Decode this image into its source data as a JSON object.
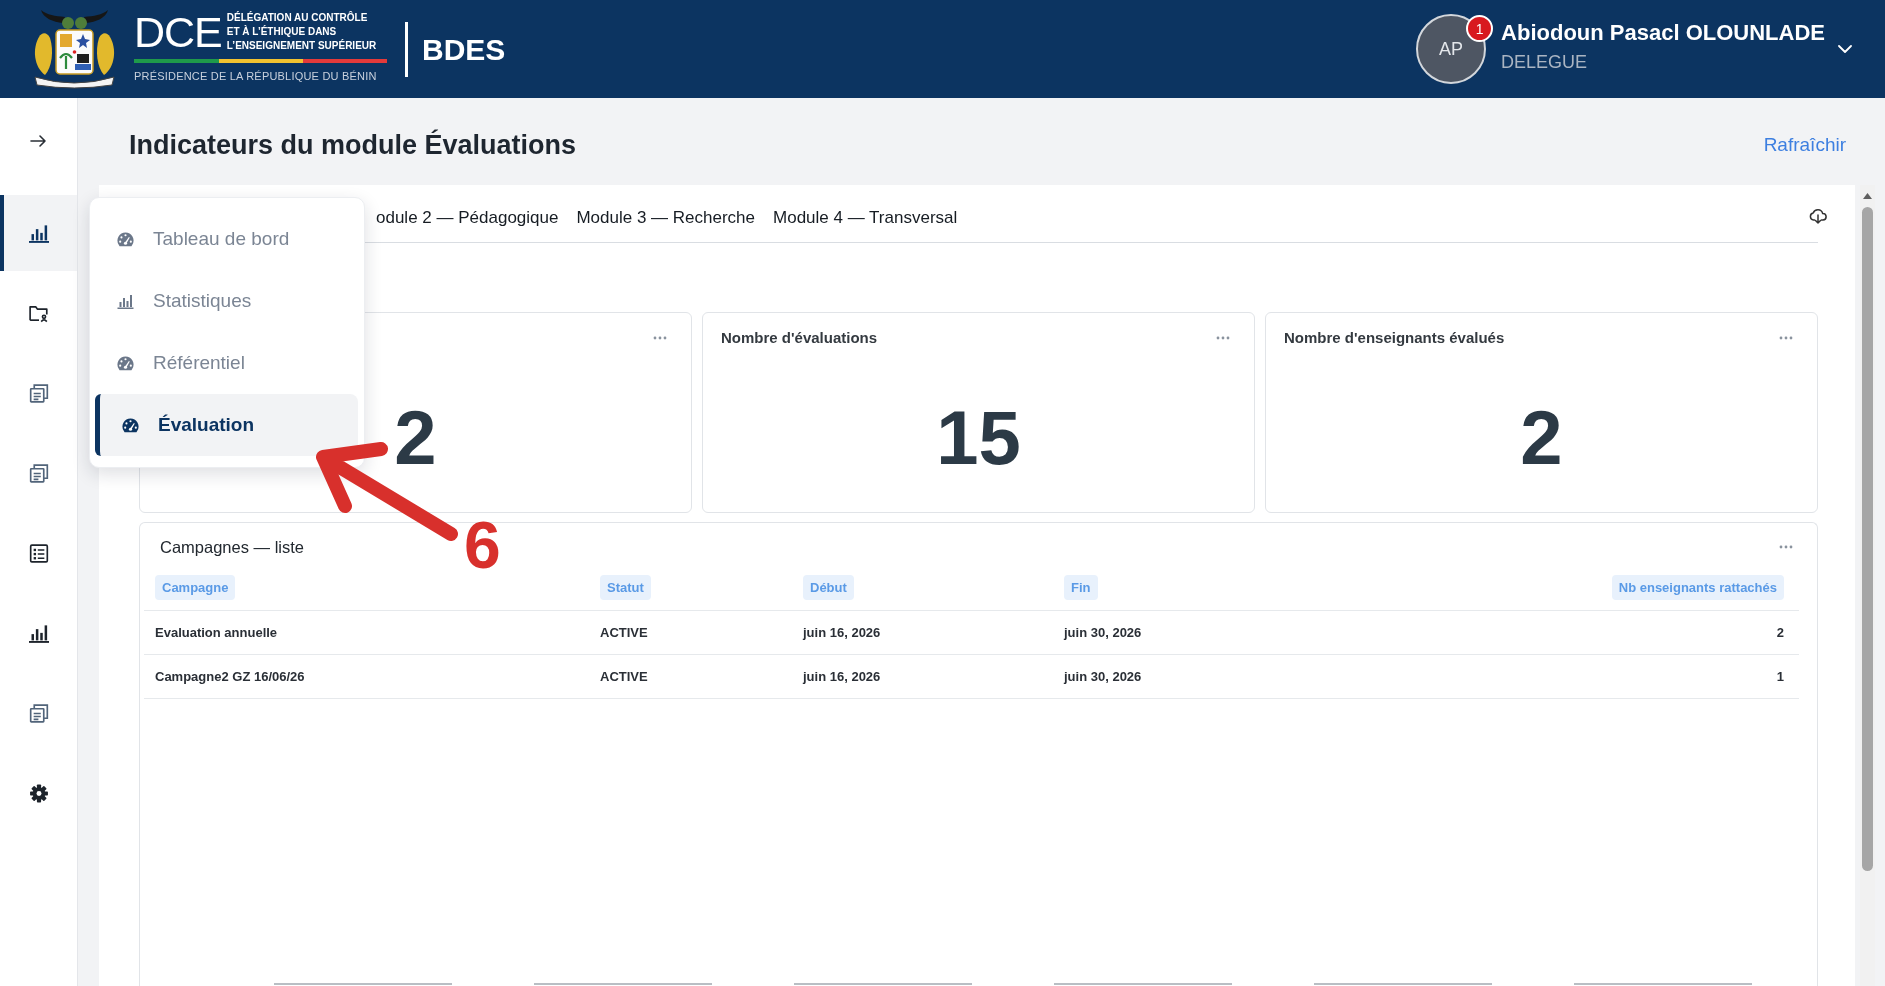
{
  "header": {
    "logo": {
      "acronym": "DCE",
      "lines": [
        "DÉLÉGATION AU CONTRÔLE",
        "ET À L’ÉTHIQUE DANS",
        "L’ENSEIGNEMENT SUPÉRIEUR"
      ],
      "subtitle": "PRÉSIDENCE DE LA RÉPUBLIQUE DU BÉNIN"
    },
    "app_name": "BDES",
    "user": {
      "initials": "AP",
      "notifications": "1",
      "name": "Abiodoun Pasacl OLOUNLADE",
      "role": "DELEGUE"
    }
  },
  "sidebar": {
    "items": [
      {
        "kind": "chart",
        "selected": true
      },
      {
        "kind": "folder",
        "selected": false
      },
      {
        "kind": "document",
        "selected": false
      },
      {
        "kind": "document",
        "selected": false
      },
      {
        "kind": "list",
        "selected": false
      },
      {
        "kind": "chart",
        "selected": false
      },
      {
        "kind": "document",
        "selected": false
      },
      {
        "kind": "settings",
        "selected": false
      }
    ]
  },
  "flyout_menu": {
    "items": [
      {
        "kind": "gauge",
        "label": "Tableau de bord",
        "selected": false
      },
      {
        "kind": "chart",
        "label": "Statistiques",
        "selected": false
      },
      {
        "kind": "gauge",
        "label": "Référentiel",
        "selected": false
      },
      {
        "kind": "gauge",
        "label": "Évaluation",
        "selected": true
      }
    ]
  },
  "page": {
    "title": "Indicateurs du module Évaluations",
    "refresh_link": "Rafraîchir"
  },
  "tabs": [
    {
      "label": "odule 2 — Pédagogique",
      "selected": false
    },
    {
      "label": "Module 3 — Recherche",
      "selected": false
    },
    {
      "label": "Module 4 — Transversal",
      "selected": false
    }
  ],
  "kpi_cards": [
    {
      "value": "2"
    },
    {
      "title": "Nombre d'évaluations",
      "value": "15"
    },
    {
      "title": "Nombre d'enseignants évalués",
      "value": "2"
    }
  ],
  "campaigns_table": {
    "title": "Campagnes — liste",
    "columns": [
      "Campagne",
      "Statut",
      "Début",
      "Fin",
      "Nb enseignants rattachés"
    ],
    "rows": [
      [
        "Evaluation annuelle",
        "ACTIVE",
        "juin 16, 2026",
        "juin 30, 2026",
        "2"
      ],
      [
        "Campagne2 GZ 16/06/26",
        "ACTIVE",
        "juin 16, 2026",
        "juin 30, 2026",
        "1"
      ]
    ]
  },
  "annotation": {
    "label": "6"
  }
}
